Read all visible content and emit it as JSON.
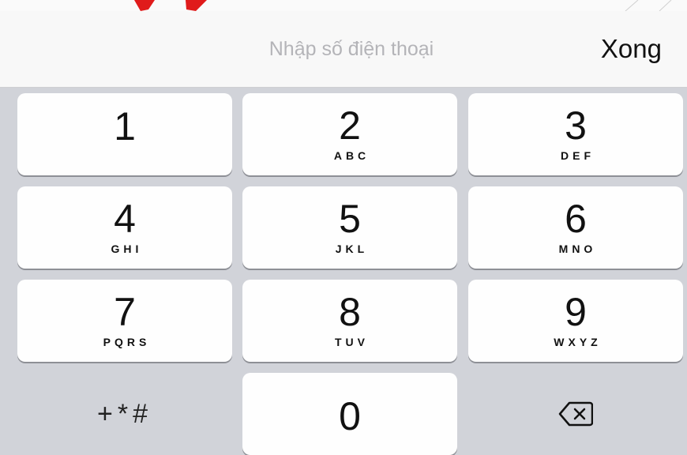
{
  "toolbar": {
    "placeholder": "Nhập số điện thoại",
    "done_label": "Xong"
  },
  "keypad": {
    "keys": [
      {
        "digit": "1",
        "letters": ""
      },
      {
        "digit": "2",
        "letters": "ABC"
      },
      {
        "digit": "3",
        "letters": "DEF"
      },
      {
        "digit": "4",
        "letters": "GHI"
      },
      {
        "digit": "5",
        "letters": "JKL"
      },
      {
        "digit": "6",
        "letters": "MNO"
      },
      {
        "digit": "7",
        "letters": "PQRS"
      },
      {
        "digit": "8",
        "letters": "TUV"
      },
      {
        "digit": "9",
        "letters": "WXYZ"
      },
      {
        "digit": "0",
        "letters": ""
      }
    ],
    "symbols_label": "+*#",
    "delete_icon": "backspace-icon"
  },
  "colors": {
    "keypad_background": "#d1d3d9",
    "key_background": "#fefefe",
    "toolbar_background": "#f8f8f8",
    "placeholder_text": "#b4b4b8",
    "annotation_arrow": "#e01b1b"
  }
}
